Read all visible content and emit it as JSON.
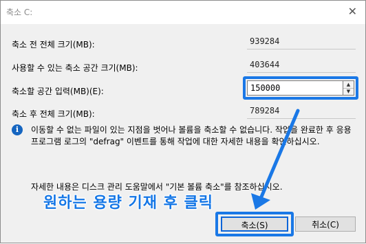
{
  "window": {
    "title": "축소 C:",
    "close_glyph": "✕"
  },
  "fields": {
    "total_before": {
      "label": "축소 전 전체 크기(MB):",
      "value": "939284"
    },
    "available": {
      "label": "사용할 수 있는 축소 공간 크기(MB):",
      "value": "403644"
    },
    "shrink_amount": {
      "label": "축소할 공간 입력(MB)(E):",
      "value": "150000"
    },
    "total_after": {
      "label": "축소 후 전체 크기(MB):",
      "value": "789284"
    }
  },
  "spinner": {
    "up_glyph": "▲",
    "down_glyph": "▼"
  },
  "info": {
    "icon_glyph": "i",
    "text": "이동할 수 없는 파일이 있는 지점을 벗어나 볼륨을 축소할 수 없습니다. 작업을 완료한 후 응용 프로그램 로그의 \"defrag\" 이벤트를 통해 작업에 대한 자세한 내용을 확인하십시오."
  },
  "footer_text": "자세한 내용은 디스크 관리 도움말에서 \"기본 볼륨 축소\"를 참조하십시오.",
  "annotation": "원하는 용량 기재 후 클릭",
  "buttons": {
    "ok": "축소(S)",
    "cancel": "취소(C)"
  },
  "colors": {
    "highlight": "#1a78e6",
    "info_icon": "#1565c0"
  }
}
